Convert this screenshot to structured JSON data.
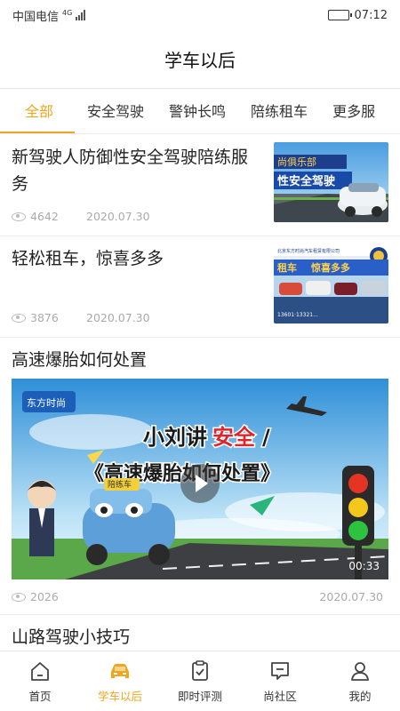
{
  "status_bar": {
    "carrier": "中国电信",
    "network": "4G",
    "time": "07:12",
    "battery_level": 0.85
  },
  "header": {
    "title": "学车以后"
  },
  "tabs": [
    {
      "label": "全部",
      "active": true
    },
    {
      "label": "安全驾驶",
      "active": false
    },
    {
      "label": "警钟长鸣",
      "active": false
    },
    {
      "label": "陪练租车",
      "active": false
    },
    {
      "label": "更多服",
      "active": false
    }
  ],
  "articles": [
    {
      "title": "新驾驶人防御性安全驾驶陪练服务",
      "views": "4642",
      "date": "2020.07.30",
      "thumb_text": [
        "尚俱乐部",
        "性安全驾驶"
      ]
    },
    {
      "title": "轻松租车，惊喜多多",
      "views": "3876",
      "date": "2020.07.30",
      "thumb_text": [
        "北京东方时尚汽车租赁有限公司",
        "租车",
        "惊喜多多",
        "13601·13321..."
      ]
    },
    {
      "title": "高速爆胎如何处置",
      "views": "2026",
      "date": "2020.07.30",
      "duration": "00:33",
      "video_text": {
        "logo": "东方时尚",
        "line1_a": "小刘讲",
        "line1_b": "安全",
        "line1_c": "/",
        "line2": "《高速爆胎如何处置》",
        "car_sign": "陪练车"
      }
    },
    {
      "title": "山路驾驶小技巧"
    }
  ],
  "bottom_nav": [
    {
      "label": "首页",
      "icon": "home-icon",
      "active": false
    },
    {
      "label": "学车以后",
      "icon": "car-icon",
      "active": true
    },
    {
      "label": "即时评测",
      "icon": "clipboard-check-icon",
      "active": false
    },
    {
      "label": "尚社区",
      "icon": "chat-icon",
      "active": false
    },
    {
      "label": "我的",
      "icon": "user-icon",
      "active": false
    }
  ],
  "colors": {
    "accent": "#f0a51e",
    "text": "#222222",
    "muted": "#aaaaaa"
  }
}
